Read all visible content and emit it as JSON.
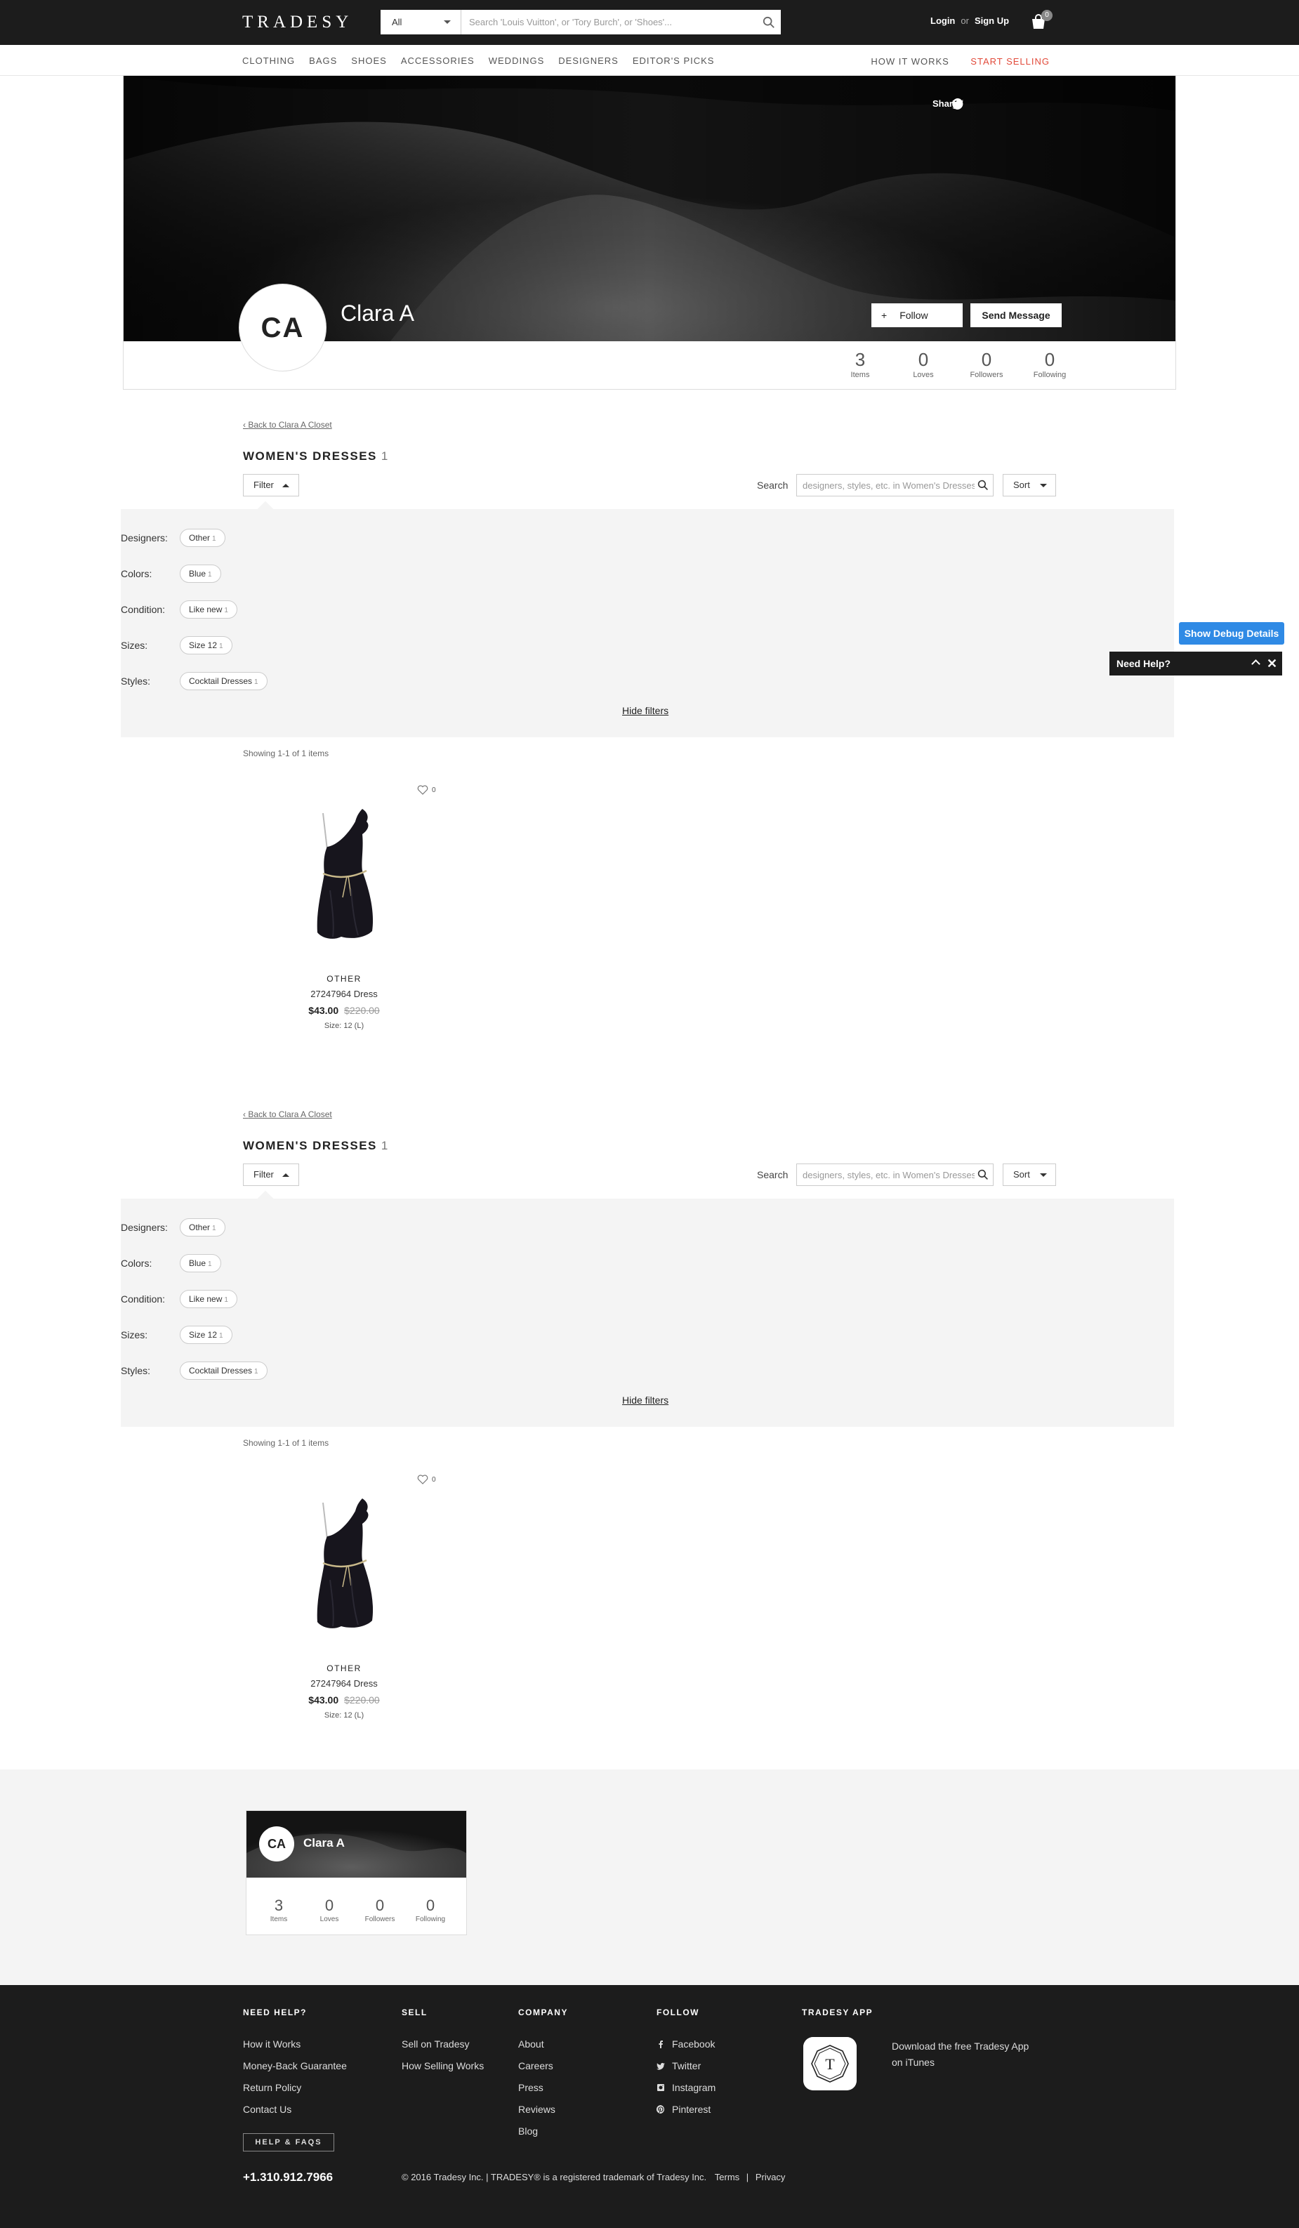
{
  "header": {
    "logo": "TRADESY",
    "search_category": "All",
    "search_placeholder": "Search 'Louis Vuitton', or 'Tory Burch', or 'Shoes'...",
    "login": "Login",
    "or": "or",
    "signup": "Sign Up",
    "cart_count": "0"
  },
  "nav": {
    "left": [
      "CLOTHING",
      "BAGS",
      "SHOES",
      "ACCESSORIES",
      "WEDDINGS",
      "DESIGNERS",
      "EDITOR'S PICKS"
    ],
    "how_it_works": "HOW IT WORKS",
    "start_selling": "START SELLING"
  },
  "profile": {
    "share_label": "Share:",
    "initials": "CA",
    "name": "Clara A",
    "follow_label": "Follow",
    "message_label": "Send Message",
    "stats": [
      {
        "n": "3",
        "label": "Items"
      },
      {
        "n": "0",
        "label": "Loves"
      },
      {
        "n": "0",
        "label": "Followers"
      },
      {
        "n": "0",
        "label": "Following"
      }
    ]
  },
  "listing": {
    "back_link": "Back to Clara A Closet",
    "title": "WOMEN'S DRESSES",
    "count": "1",
    "filter_label": "Filter",
    "search_label": "Search",
    "search_placeholder": "designers, styles, etc. in Women's Dresses",
    "sort_label": "Sort",
    "filters": [
      {
        "label": "Designers:",
        "chip": "Other",
        "count": "1"
      },
      {
        "label": "Colors:",
        "chip": "Blue",
        "count": "1"
      },
      {
        "label": "Condition:",
        "chip": "Like new",
        "count": "1"
      },
      {
        "label": "Sizes:",
        "chip": "Size 12",
        "count": "1"
      },
      {
        "label": "Styles:",
        "chip": "Cocktail Dresses",
        "count": "1"
      }
    ],
    "hide_filters": "Hide filters",
    "showing": "Showing 1-1 of 1 items",
    "product": {
      "loves": "0",
      "designer": "OTHER",
      "name": "27247964 Dress",
      "price": "$43.00",
      "original_price": "$220.00",
      "size": "Size: 12 (L)"
    }
  },
  "debug_button": "Show Debug Details",
  "need_help_widget": "Need Help?",
  "mini_profile": {
    "initials": "CA",
    "name": "Clara A",
    "stats": [
      {
        "n": "3",
        "label": "Items"
      },
      {
        "n": "0",
        "label": "Loves"
      },
      {
        "n": "0",
        "label": "Followers"
      },
      {
        "n": "0",
        "label": "Following"
      }
    ]
  },
  "footer": {
    "need_help": {
      "heading": "NEED HELP?",
      "links": [
        "How it Works",
        "Money-Back Guarantee",
        "Return Policy",
        "Contact Us"
      ]
    },
    "sell": {
      "heading": "SELL",
      "links": [
        "Sell on Tradesy",
        "How Selling Works"
      ]
    },
    "company": {
      "heading": "COMPANY",
      "links": [
        "About",
        "Careers",
        "Press",
        "Reviews",
        "Blog"
      ]
    },
    "follow": {
      "heading": "FOLLOW",
      "links": [
        "Facebook",
        "Twitter",
        "Instagram",
        "Pinterest"
      ]
    },
    "app": {
      "heading": "TRADESY APP",
      "text": "Download the free Tradesy App on iTunes"
    },
    "help_faqs": "HELP & FAQS",
    "phone": "+1.310.912.7966",
    "copyright": "© 2016 Tradesy Inc. | TRADESY® is a registered trademark of Tradesy Inc.",
    "terms": "Terms",
    "sep": "|",
    "privacy": "Privacy"
  }
}
